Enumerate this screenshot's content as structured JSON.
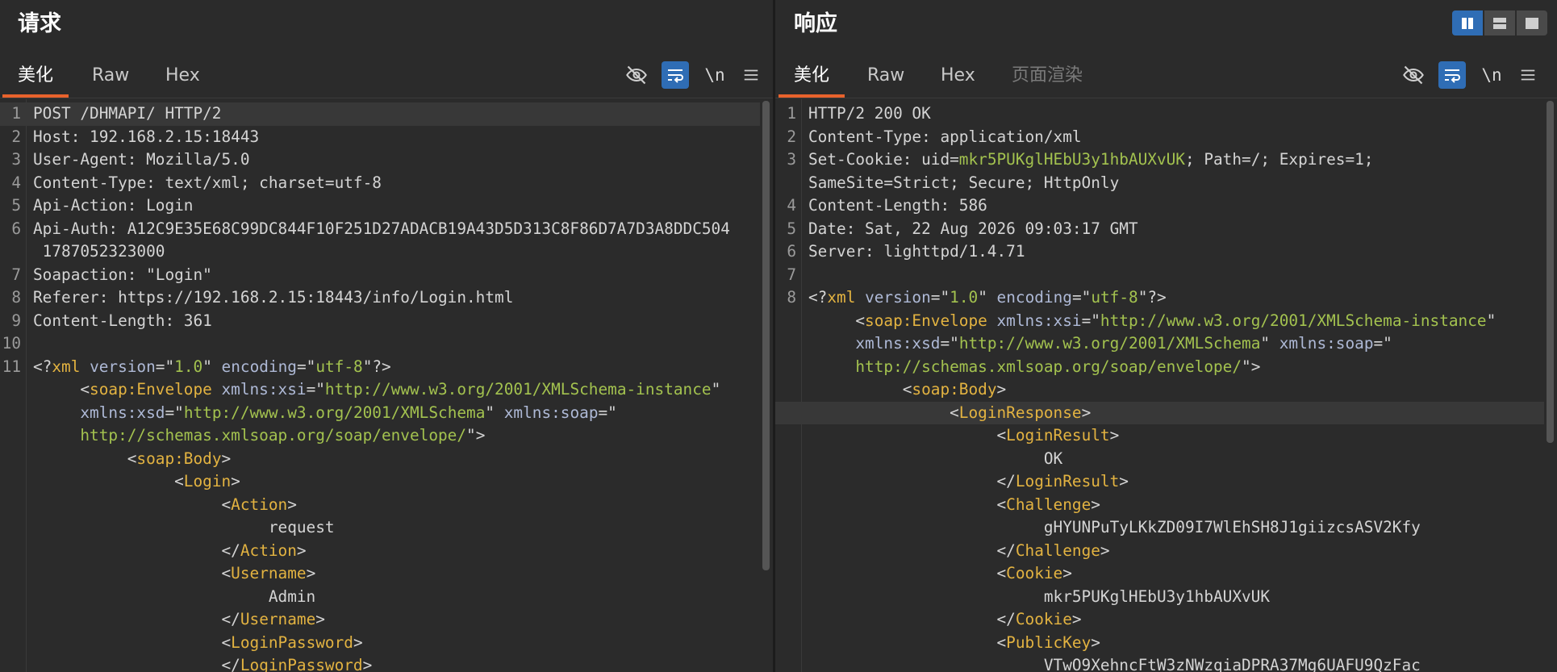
{
  "request": {
    "title": "请求",
    "tabs": [
      {
        "label": "美化",
        "active": true
      },
      {
        "label": "Raw",
        "active": false
      },
      {
        "label": "Hex",
        "active": false
      }
    ],
    "newline_label": "\\n",
    "lines": [
      {
        "n": "1",
        "segs": [
          [
            "k",
            "POST /DHMAPI/ HTTP/2"
          ]
        ]
      },
      {
        "n": "2",
        "segs": [
          [
            "k",
            "Host: 192.168.2.15:18443"
          ]
        ]
      },
      {
        "n": "3",
        "segs": [
          [
            "k",
            "User-Agent: Mozilla/5.0"
          ]
        ]
      },
      {
        "n": "4",
        "segs": [
          [
            "k",
            "Content-Type: text/xml; charset=utf-8"
          ]
        ]
      },
      {
        "n": "5",
        "segs": [
          [
            "k",
            "Api-Action: Login"
          ]
        ]
      },
      {
        "n": "6",
        "segs": [
          [
            "k",
            "Api-Auth: A12C9E35E68C99DC844F10F251D27ADACB19A43D5D313C8F86D7A7D3A8DDC504"
          ]
        ]
      },
      {
        "n": "",
        "segs": [
          [
            "k",
            " 1787052323000"
          ]
        ]
      },
      {
        "n": "7",
        "segs": [
          [
            "k",
            "Soapaction: \"Login\""
          ]
        ]
      },
      {
        "n": "8",
        "segs": [
          [
            "k",
            "Referer: https://192.168.2.15:18443/info/Login.html"
          ]
        ]
      },
      {
        "n": "9",
        "segs": [
          [
            "k",
            "Content-Length: 361"
          ]
        ]
      },
      {
        "n": "10",
        "segs": []
      },
      {
        "n": "11",
        "segs": [
          [
            "k",
            "<?"
          ],
          [
            "t",
            "xml"
          ],
          [
            "a",
            " version"
          ],
          [
            "k",
            "=\""
          ],
          [
            "s",
            "1.0"
          ],
          [
            "k",
            "\""
          ],
          [
            "a",
            " encoding"
          ],
          [
            "k",
            "=\""
          ],
          [
            "s",
            "utf-8"
          ],
          [
            "k",
            "\"?>"
          ]
        ]
      },
      {
        "n": "",
        "segs": [
          [
            "k",
            "     <"
          ],
          [
            "t",
            "soap:Envelope"
          ],
          [
            "a",
            " xmlns:xsi"
          ],
          [
            "k",
            "=\""
          ],
          [
            "s",
            "http://www.w3.org/2001/XMLSchema-instance"
          ],
          [
            "k",
            "\""
          ]
        ]
      },
      {
        "n": "",
        "segs": [
          [
            "a",
            "     xmlns:xsd"
          ],
          [
            "k",
            "=\""
          ],
          [
            "s",
            "http://www.w3.org/2001/XMLSchema"
          ],
          [
            "k",
            "\""
          ],
          [
            "a",
            " xmlns:soap"
          ],
          [
            "k",
            "=\""
          ]
        ]
      },
      {
        "n": "",
        "segs": [
          [
            "s",
            "     http://schemas.xmlsoap.org/soap/envelope/"
          ],
          [
            "k",
            "\">"
          ]
        ]
      },
      {
        "n": "",
        "segs": [
          [
            "k",
            "          <"
          ],
          [
            "t",
            "soap:Body"
          ],
          [
            "k",
            ">"
          ]
        ]
      },
      {
        "n": "",
        "segs": [
          [
            "k",
            "               <"
          ],
          [
            "t",
            "Login"
          ],
          [
            "k",
            ">"
          ]
        ]
      },
      {
        "n": "",
        "segs": [
          [
            "k",
            "                    <"
          ],
          [
            "t",
            "Action"
          ],
          [
            "k",
            ">"
          ]
        ]
      },
      {
        "n": "",
        "segs": [
          [
            "k",
            "                         request"
          ]
        ]
      },
      {
        "n": "",
        "segs": [
          [
            "k",
            "                    </"
          ],
          [
            "t",
            "Action"
          ],
          [
            "k",
            ">"
          ]
        ]
      },
      {
        "n": "",
        "segs": [
          [
            "k",
            "                    <"
          ],
          [
            "t",
            "Username"
          ],
          [
            "k",
            ">"
          ]
        ]
      },
      {
        "n": "",
        "segs": [
          [
            "k",
            "                         Admin"
          ]
        ]
      },
      {
        "n": "",
        "segs": [
          [
            "k",
            "                    </"
          ],
          [
            "t",
            "Username"
          ],
          [
            "k",
            ">"
          ]
        ]
      },
      {
        "n": "",
        "segs": [
          [
            "k",
            "                    <"
          ],
          [
            "t",
            "LoginPassword"
          ],
          [
            "k",
            ">"
          ]
        ]
      },
      {
        "n": "",
        "segs": [
          [
            "k",
            "                    </"
          ],
          [
            "t",
            "LoginPassword"
          ],
          [
            "k",
            ">"
          ]
        ]
      }
    ]
  },
  "response": {
    "title": "响应",
    "tabs": [
      {
        "label": "美化",
        "active": true
      },
      {
        "label": "Raw",
        "active": false
      },
      {
        "label": "Hex",
        "active": false
      },
      {
        "label": "页面渲染",
        "active": false,
        "disabled": true
      }
    ],
    "newline_label": "\\n",
    "lines": [
      {
        "n": "1",
        "segs": [
          [
            "k",
            "HTTP/2 200 OK"
          ]
        ]
      },
      {
        "n": "2",
        "segs": [
          [
            "k",
            "Content-Type: application/xml"
          ]
        ]
      },
      {
        "n": "3",
        "segs": [
          [
            "k",
            "Set-Cookie: uid="
          ],
          [
            "s",
            "mkr5PUKglHEbU3y1hbAUXvUK"
          ],
          [
            "k",
            "; Path=/; Expires=1;"
          ]
        ]
      },
      {
        "n": "",
        "segs": [
          [
            "k",
            "SameSite=Strict; Secure; HttpOnly"
          ]
        ]
      },
      {
        "n": "4",
        "segs": [
          [
            "k",
            "Content-Length: 586"
          ]
        ]
      },
      {
        "n": "5",
        "segs": [
          [
            "k",
            "Date: Sat, 22 Aug 2026 09:03:17 GMT"
          ]
        ]
      },
      {
        "n": "6",
        "segs": [
          [
            "k",
            "Server: lighttpd/1.4.71"
          ]
        ]
      },
      {
        "n": "7",
        "segs": []
      },
      {
        "n": "8",
        "segs": [
          [
            "k",
            "<?"
          ],
          [
            "t",
            "xml"
          ],
          [
            "a",
            " version"
          ],
          [
            "k",
            "=\""
          ],
          [
            "s",
            "1.0"
          ],
          [
            "k",
            "\""
          ],
          [
            "a",
            " encoding"
          ],
          [
            "k",
            "=\""
          ],
          [
            "s",
            "utf-8"
          ],
          [
            "k",
            "\"?>"
          ]
        ]
      },
      {
        "n": "",
        "segs": [
          [
            "k",
            "     <"
          ],
          [
            "t",
            "soap:Envelope"
          ],
          [
            "a",
            " xmlns:xsi"
          ],
          [
            "k",
            "=\""
          ],
          [
            "s",
            "http://www.w3.org/2001/XMLSchema-instance"
          ],
          [
            "k",
            "\""
          ]
        ]
      },
      {
        "n": "",
        "segs": [
          [
            "a",
            "     xmlns:xsd"
          ],
          [
            "k",
            "=\""
          ],
          [
            "s",
            "http://www.w3.org/2001/XMLSchema"
          ],
          [
            "k",
            "\""
          ],
          [
            "a",
            " xmlns:soap"
          ],
          [
            "k",
            "=\""
          ]
        ]
      },
      {
        "n": "",
        "segs": [
          [
            "s",
            "     http://schemas.xmlsoap.org/soap/envelope/"
          ],
          [
            "k",
            "\">"
          ]
        ]
      },
      {
        "n": "",
        "segs": [
          [
            "k",
            "          <"
          ],
          [
            "t",
            "soap:Body"
          ],
          [
            "k",
            ">"
          ]
        ]
      },
      {
        "n": "",
        "segs": [
          [
            "k",
            "               <"
          ],
          [
            "t",
            "LoginResponse"
          ],
          [
            "k",
            ">"
          ]
        ]
      },
      {
        "n": "",
        "segs": [
          [
            "k",
            "                    <"
          ],
          [
            "t",
            "LoginResult"
          ],
          [
            "k",
            ">"
          ]
        ]
      },
      {
        "n": "",
        "segs": [
          [
            "k",
            "                         OK"
          ]
        ]
      },
      {
        "n": "",
        "segs": [
          [
            "k",
            "                    </"
          ],
          [
            "t",
            "LoginResult"
          ],
          [
            "k",
            ">"
          ]
        ]
      },
      {
        "n": "",
        "segs": [
          [
            "k",
            "                    <"
          ],
          [
            "t",
            "Challenge"
          ],
          [
            "k",
            ">"
          ]
        ]
      },
      {
        "n": "",
        "segs": [
          [
            "k",
            "                         gHYUNPuTyLKkZD09I7WlEhSH8J1giizcsASV2Kfy"
          ]
        ]
      },
      {
        "n": "",
        "segs": [
          [
            "k",
            "                    </"
          ],
          [
            "t",
            "Challenge"
          ],
          [
            "k",
            ">"
          ]
        ]
      },
      {
        "n": "",
        "segs": [
          [
            "k",
            "                    <"
          ],
          [
            "t",
            "Cookie"
          ],
          [
            "k",
            ">"
          ]
        ]
      },
      {
        "n": "",
        "segs": [
          [
            "k",
            "                         mkr5PUKglHEbU3y1hbAUXvUK"
          ]
        ]
      },
      {
        "n": "",
        "segs": [
          [
            "k",
            "                    </"
          ],
          [
            "t",
            "Cookie"
          ],
          [
            "k",
            ">"
          ]
        ]
      },
      {
        "n": "",
        "segs": [
          [
            "k",
            "                    <"
          ],
          [
            "t",
            "PublicKey"
          ],
          [
            "k",
            ">"
          ]
        ]
      },
      {
        "n": "",
        "segs": [
          [
            "k",
            "                         VTwO9XehncFtW3zNWzqiaDPRA37Mg6UAFU9QzFac"
          ]
        ]
      }
    ]
  }
}
